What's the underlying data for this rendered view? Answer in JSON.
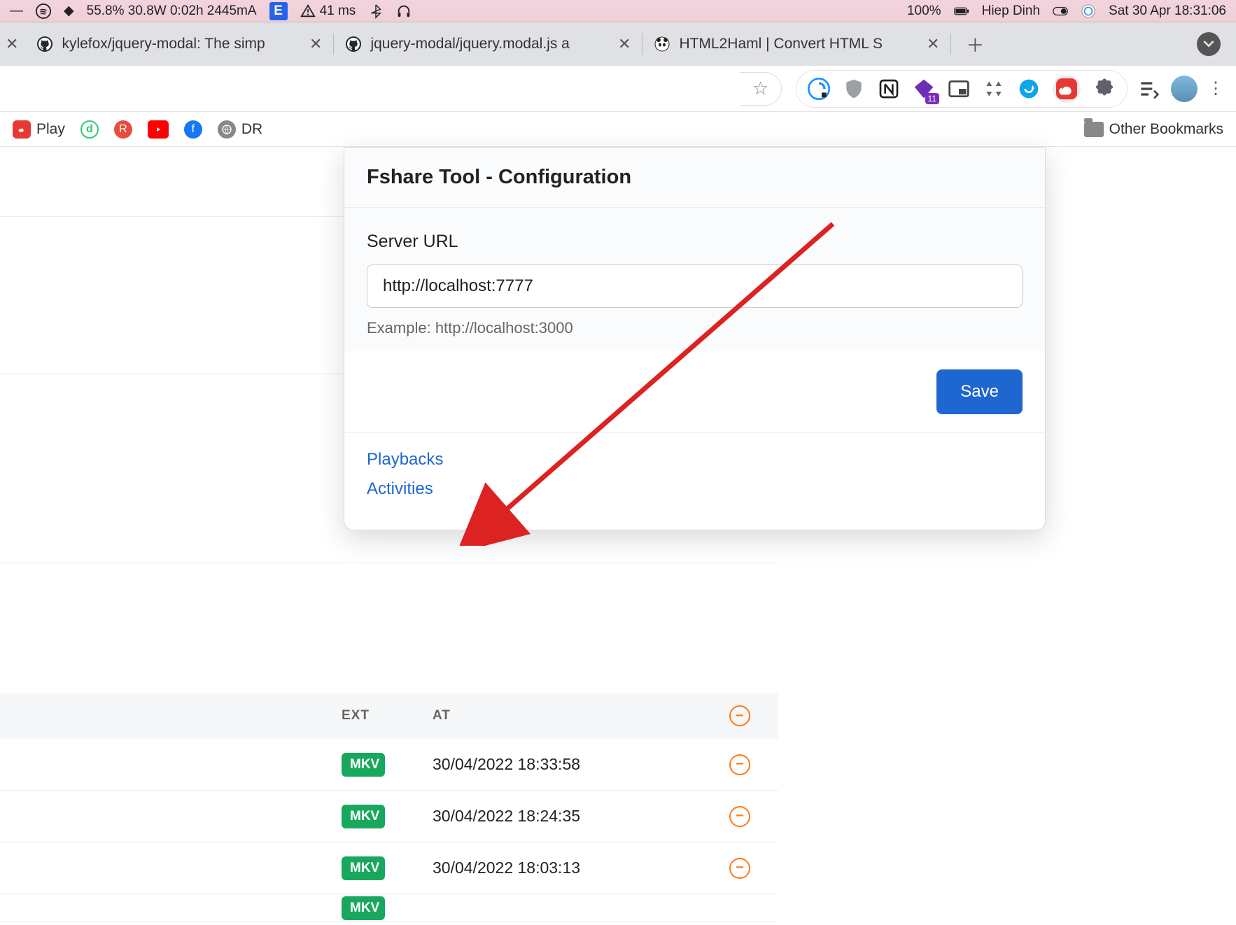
{
  "menubar": {
    "cpu_text": "55.8% 30.8W 0:02h 2445mA",
    "latency": "41 ms",
    "battery": "100%",
    "user": "Hiep Dinh",
    "clock": "Sat 30 Apr 18:31:06"
  },
  "tabs": [
    {
      "title": "kylefox/jquery-modal: The simp"
    },
    {
      "title": "jquery-modal/jquery.modal.js a"
    },
    {
      "title": "HTML2Haml | Convert HTML S"
    }
  ],
  "bookmarks": {
    "play": "Play",
    "dr": "DR",
    "other": "Other Bookmarks"
  },
  "ext_badge": "11",
  "popup": {
    "title": "Fshare Tool - Configuration",
    "server_url_label": "Server URL",
    "server_url_value": "http://localhost:7777",
    "server_url_hint": "Example: http://localhost:3000",
    "save_label": "Save",
    "link_playbacks": "Playbacks",
    "link_activities": "Activities"
  },
  "table": {
    "header_ext": "EXT",
    "header_at": "AT",
    "rows": [
      {
        "ext": "MKV",
        "at": "30/04/2022 18:33:58"
      },
      {
        "ext": "MKV",
        "at": "30/04/2022 18:24:35"
      },
      {
        "ext": "MKV",
        "at": "30/04/2022 18:03:13"
      },
      {
        "ext": "MKV",
        "at": ""
      }
    ]
  }
}
